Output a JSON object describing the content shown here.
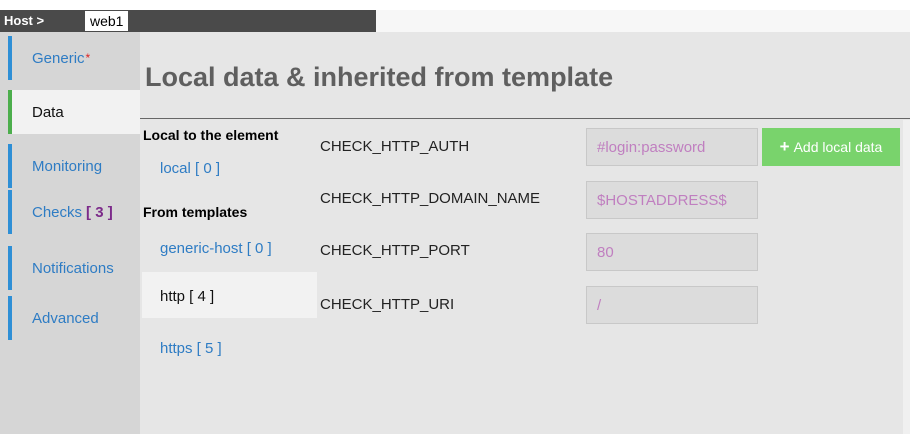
{
  "breadcrumb": {
    "host_label": "Host >",
    "host_name": "web1"
  },
  "sidebar": {
    "items": [
      {
        "label": "Generic",
        "required_mark": "*"
      },
      {
        "label": "Data"
      },
      {
        "label": "Monitoring"
      },
      {
        "label": "Checks",
        "count": "[ 3 ]"
      },
      {
        "label": "Notifications"
      },
      {
        "label": "Advanced"
      }
    ]
  },
  "main": {
    "title": "Local data & inherited from template",
    "local_heading": "Local to the element",
    "local_item": "local [ 0 ]",
    "templates_heading": "From templates",
    "templates": [
      {
        "label": "generic-host [ 0 ]"
      },
      {
        "label": "http [ 4 ]",
        "selected": true
      },
      {
        "label": "https [ 5 ]"
      }
    ],
    "variables": [
      {
        "name": "CHECK_HTTP_AUTH",
        "value": "#login:password"
      },
      {
        "name": "CHECK_HTTP_DOMAIN_NAME",
        "value": "$HOSTADDRESS$"
      },
      {
        "name": "CHECK_HTTP_PORT",
        "value": "80"
      },
      {
        "name": "CHECK_HTTP_URI",
        "value": "/"
      }
    ],
    "add_button": {
      "icon": "plus-icon",
      "label": "Add local data"
    }
  },
  "colors": {
    "accent_blue": "#2e7cc4",
    "active_green": "#4cae4c",
    "button_green": "#79d36c",
    "value_purple": "#c07fc0",
    "count_purple": "#7c2a8a"
  }
}
